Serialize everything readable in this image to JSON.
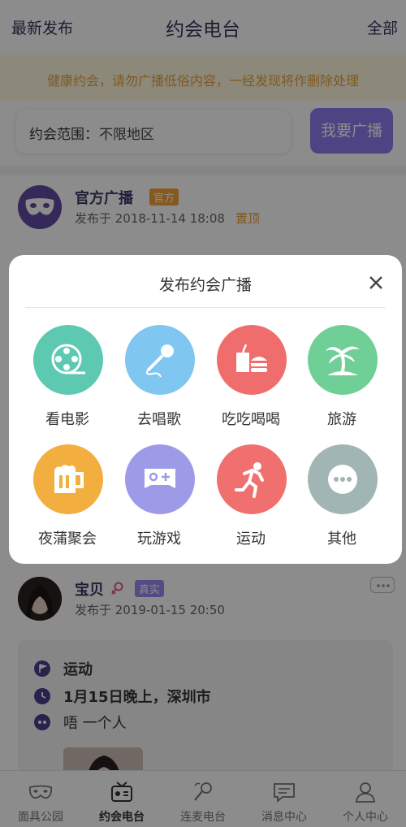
{
  "header": {
    "left": "最新发布",
    "title": "约会电台",
    "right": "全部"
  },
  "notice": "健康约会，请勿广播低俗内容，一经发现将作删除处理",
  "filter": {
    "label": "约会范围：",
    "value": "不限地区",
    "button": "我要广播"
  },
  "official_post": {
    "name": "官方广播",
    "tag": "官方",
    "time": "发布于 2018-11-14 18:08",
    "pin": "置顶"
  },
  "modal": {
    "title": "发布约会广播",
    "options": [
      {
        "label": "看电影",
        "color": "#5cc9b0",
        "icon": "film-reel-icon"
      },
      {
        "label": "去唱歌",
        "color": "#7fc6f0",
        "icon": "microphone-icon"
      },
      {
        "label": "吃吃喝喝",
        "color": "#f06d6d",
        "icon": "food-drink-icon"
      },
      {
        "label": "旅游",
        "color": "#6fcf97",
        "icon": "palm-tree-icon"
      },
      {
        "label": "夜蒲聚会",
        "color": "#f2ae3e",
        "icon": "beer-mug-icon"
      },
      {
        "label": "玩游戏",
        "color": "#9d9be8",
        "icon": "gamepad-icon"
      },
      {
        "label": "运动",
        "color": "#f07070",
        "icon": "running-man-icon"
      },
      {
        "label": "其他",
        "color": "#a2b5b5",
        "icon": "more-dots-icon"
      }
    ]
  },
  "user_post": {
    "name": "宝贝",
    "tag": "真实",
    "time": "发布于 2019-01-15 20:50",
    "activity": "运动",
    "when_where": "1月15日晚上，深圳市",
    "people": "唔 一个人"
  },
  "tabs": [
    {
      "label": "面具公园",
      "icon": "mask-icon",
      "active": false
    },
    {
      "label": "约会电台",
      "icon": "radio-icon",
      "active": true
    },
    {
      "label": "连麦电台",
      "icon": "mic-link-icon",
      "active": false
    },
    {
      "label": "消息中心",
      "icon": "message-icon",
      "active": false
    },
    {
      "label": "个人中心",
      "icon": "person-icon",
      "active": false
    }
  ]
}
